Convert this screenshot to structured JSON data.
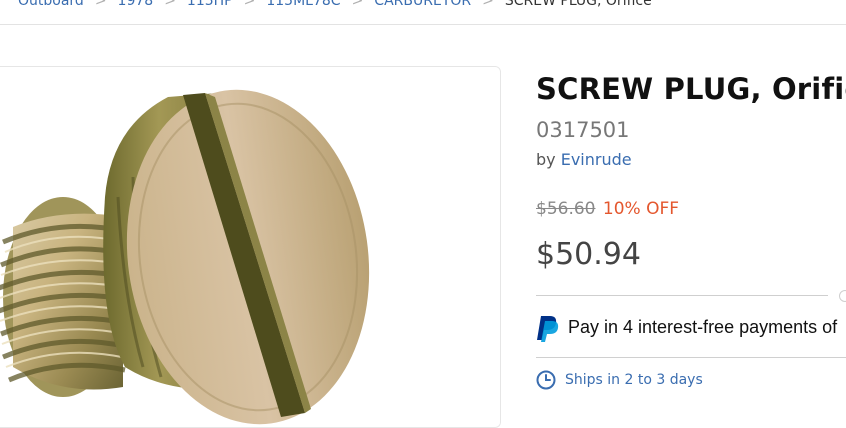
{
  "breadcrumb": {
    "items": [
      "Outboard",
      "1978",
      "115HP",
      "115ML78C",
      "CARBURETOR"
    ],
    "current": "SCREW PLUG, Orifice"
  },
  "product": {
    "title": "SCREW PLUG, Orifice",
    "sku": "0317501",
    "by_label": "by",
    "brand": "Evinrude",
    "old_price": "$56.60",
    "discount": "10% OFF",
    "price": "$50.94"
  },
  "paypal": {
    "icon": "paypal-icon",
    "text": "Pay in 4 interest-free payments of"
  },
  "shipping": {
    "icon": "clock-icon",
    "text": "Ships in 2 to 3 days"
  },
  "colors": {
    "link": "#3a6db0",
    "discount": "#e4572e",
    "paypal_dark": "#003087",
    "paypal_light": "#009cde"
  }
}
